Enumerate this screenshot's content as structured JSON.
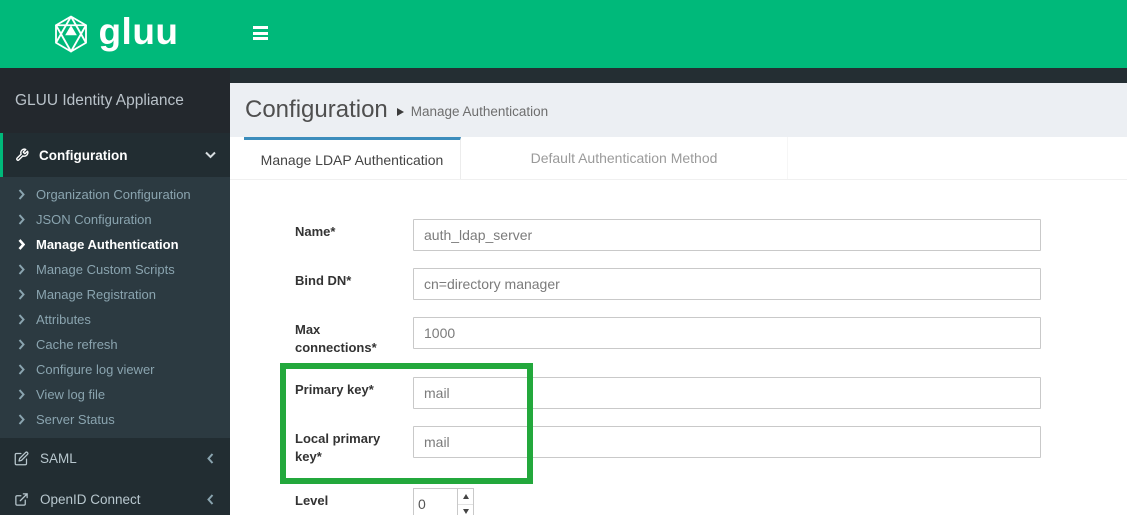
{
  "logo": {
    "text": "gluu"
  },
  "topbar": {
    "toggle_icon": "hamburger-icon"
  },
  "sidebar": {
    "title": "GLUU Identity Appliance",
    "section": {
      "label": "Configuration",
      "icon": "wrench-icon",
      "state_icon": "chevron-down-icon"
    },
    "items": [
      {
        "label": "Organization Configuration"
      },
      {
        "label": "JSON Configuration"
      },
      {
        "label": "Manage Authentication"
      },
      {
        "label": "Manage Custom Scripts"
      },
      {
        "label": "Manage Registration"
      },
      {
        "label": "Attributes"
      },
      {
        "label": "Cache refresh"
      },
      {
        "label": "Configure log viewer"
      },
      {
        "label": "View log file"
      },
      {
        "label": "Server Status"
      }
    ],
    "active_item": "Manage Authentication",
    "bottom": [
      {
        "label": "SAML",
        "icon": "pencil-square-icon",
        "state_icon": "chevron-left-icon"
      },
      {
        "label": "OpenID Connect",
        "icon": "external-link-icon",
        "state_icon": "chevron-left-icon"
      }
    ]
  },
  "breadcrumb": {
    "section": "Configuration",
    "page": "Manage Authentication"
  },
  "tabs": [
    {
      "label": "Manage LDAP Authentication",
      "active": true
    },
    {
      "label": "Default Authentication Method",
      "active": false
    }
  ],
  "form": {
    "fields": [
      {
        "label": "Name*",
        "value": "auth_ldap_server"
      },
      {
        "label": "Bind DN*",
        "value": "cn=directory manager"
      },
      {
        "label": "Max connections*",
        "value": "1000"
      },
      {
        "label": "Primary key*",
        "value": "mail"
      },
      {
        "label": "Local primary key*",
        "value": "mail"
      },
      {
        "label": "Level",
        "value": "0"
      }
    ]
  },
  "annotation": {
    "type": "highlight-rectangle",
    "color": "#23a83c"
  },
  "colors": {
    "brand_green": "#00b97a",
    "sidebar_dark": "#222d32",
    "submenu_bg": "#2c3a41",
    "tab_active_border": "#3c8dbc",
    "highlight_green": "#23a83c",
    "content_bg": "#ecf0f5"
  }
}
